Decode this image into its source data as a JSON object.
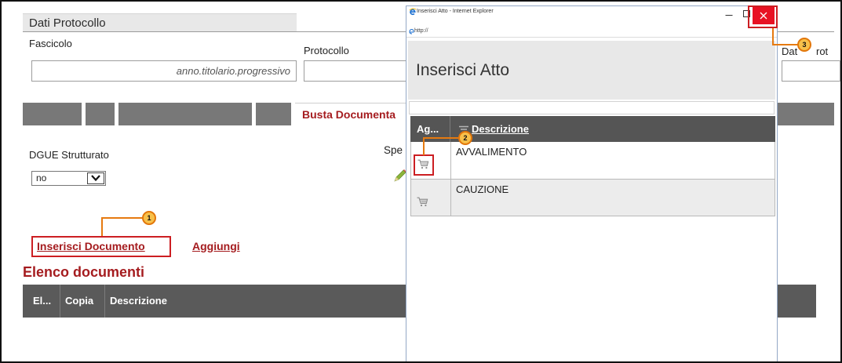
{
  "colors": {
    "brand_red": "#a51c1f",
    "annotation_red": "#cc1e22",
    "callout_orange": "#e2760a",
    "callout_fill": "#f7c04a",
    "table_header": "#5a5a5a",
    "tab_gray": "#787878",
    "window_close_red": "#e81123"
  },
  "main": {
    "section_title": "Dati Protocollo",
    "fascicolo": {
      "label": "Fascicolo",
      "value": "",
      "hint": "anno.titolario.progressivo"
    },
    "protocollo": {
      "label": "Protocollo",
      "value": ""
    },
    "data_protocollo": {
      "label_start": "Dat",
      "label_end": "rot",
      "value": ""
    },
    "active_tab": {
      "label": "Busta Documenta"
    },
    "dgue": {
      "label": "DGUE Strutturato",
      "selected": "no",
      "icon": "chevron-down-icon"
    },
    "spe_label": "Spe",
    "edit_icon": "pencil-icon",
    "links": {
      "inserisci_documento": "Inserisci Documento",
      "aggiungi": "Aggiungi"
    },
    "list_title": "Elenco documenti",
    "table": {
      "columns": [
        "El...",
        "Copia",
        "Descrizione"
      ]
    }
  },
  "popup": {
    "window_title": "Inserisci Atto - Internet Explorer",
    "browser_icon": "ie-logo-icon",
    "address": "http://",
    "controls": {
      "minimize": "minimize-icon",
      "maximize": "maximize-icon",
      "close": "close-icon"
    },
    "heading": "Inserisci Atto",
    "table": {
      "columns": [
        "Ag...",
        "Descrizione"
      ],
      "sort_icon": "sort-icon",
      "rows": [
        {
          "action_icon": "cart-icon",
          "descrizione": "AVVALIMENTO"
        },
        {
          "action_icon": "cart-icon",
          "descrizione": "CAUZIONE"
        }
      ]
    }
  },
  "callouts": [
    {
      "number": "1"
    },
    {
      "number": "2"
    },
    {
      "number": "3"
    }
  ]
}
